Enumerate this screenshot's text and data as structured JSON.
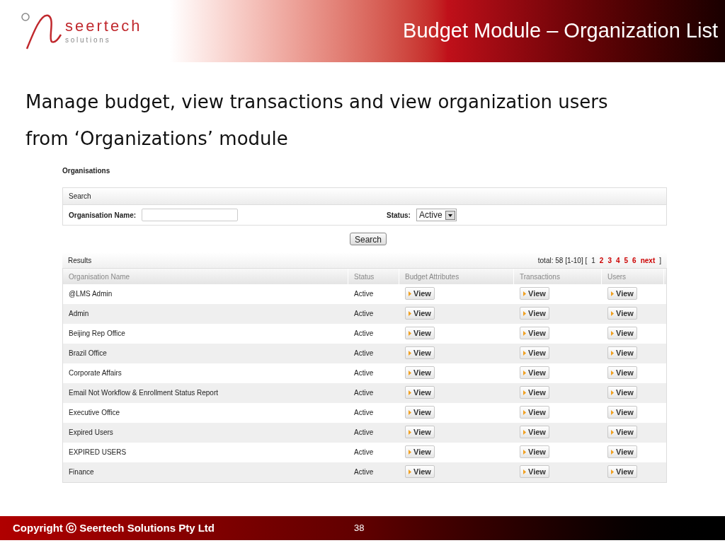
{
  "header": {
    "logo": {
      "brand": "seertech",
      "tagline": "s o l u t i o n s"
    },
    "title": "Budget Module – Organization List"
  },
  "intro": "Manage budget, view transactions and view organization users from ‘Organizations’ module",
  "screen": {
    "page_title": "Organisations",
    "search": {
      "heading": "Search",
      "name_label": "Organisation Name:",
      "status_label": "Status:",
      "status_value": "Active",
      "button": "Search"
    },
    "results": {
      "heading": "Results",
      "total": "total: 58 [1-10] [",
      "pages": [
        {
          "label": "1",
          "selected": true
        },
        {
          "label": "2",
          "selected": false
        },
        {
          "label": "3",
          "selected": false
        },
        {
          "label": "4",
          "selected": false
        },
        {
          "label": "5",
          "selected": false
        },
        {
          "label": "6",
          "selected": false
        }
      ],
      "next": "next",
      "close": "]",
      "columns": [
        "Organisation Name",
        "Status",
        "Budget Attributes",
        "Transactions",
        "Users"
      ],
      "rows": [
        {
          "name": "@LMS Admin",
          "status": "Active",
          "actions": [
            "View",
            "View",
            "View"
          ]
        },
        {
          "name": "Admin",
          "status": "Active",
          "actions": [
            "View",
            "View",
            "View"
          ]
        },
        {
          "name": "Beijing Rep Office",
          "status": "Active",
          "actions": [
            "View",
            "View",
            "View"
          ]
        },
        {
          "name": "Brazil Office",
          "status": "Active",
          "actions": [
            "View",
            "View",
            "View"
          ]
        },
        {
          "name": "Corporate Affairs",
          "status": "Active",
          "actions": [
            "View",
            "View",
            "View"
          ]
        },
        {
          "name": "Email Not Workflow & Enrollment Status Report",
          "status": "Active",
          "actions": [
            "View",
            "View",
            "View"
          ]
        },
        {
          "name": "Executive Office",
          "status": "Active",
          "actions": [
            "View",
            "View",
            "View"
          ]
        },
        {
          "name": "Expired Users",
          "status": "Active",
          "actions": [
            "View",
            "View",
            "View"
          ]
        },
        {
          "name": "EXPIRED USERS",
          "status": "Active",
          "actions": [
            "View",
            "View",
            "View"
          ]
        },
        {
          "name": "Finance",
          "status": "Active",
          "actions": [
            "View",
            "View",
            "View"
          ]
        }
      ]
    }
  },
  "footer": {
    "copyright": "Copyright ⓒ Seertech Solutions Pty Ltd",
    "page_number": "38"
  }
}
